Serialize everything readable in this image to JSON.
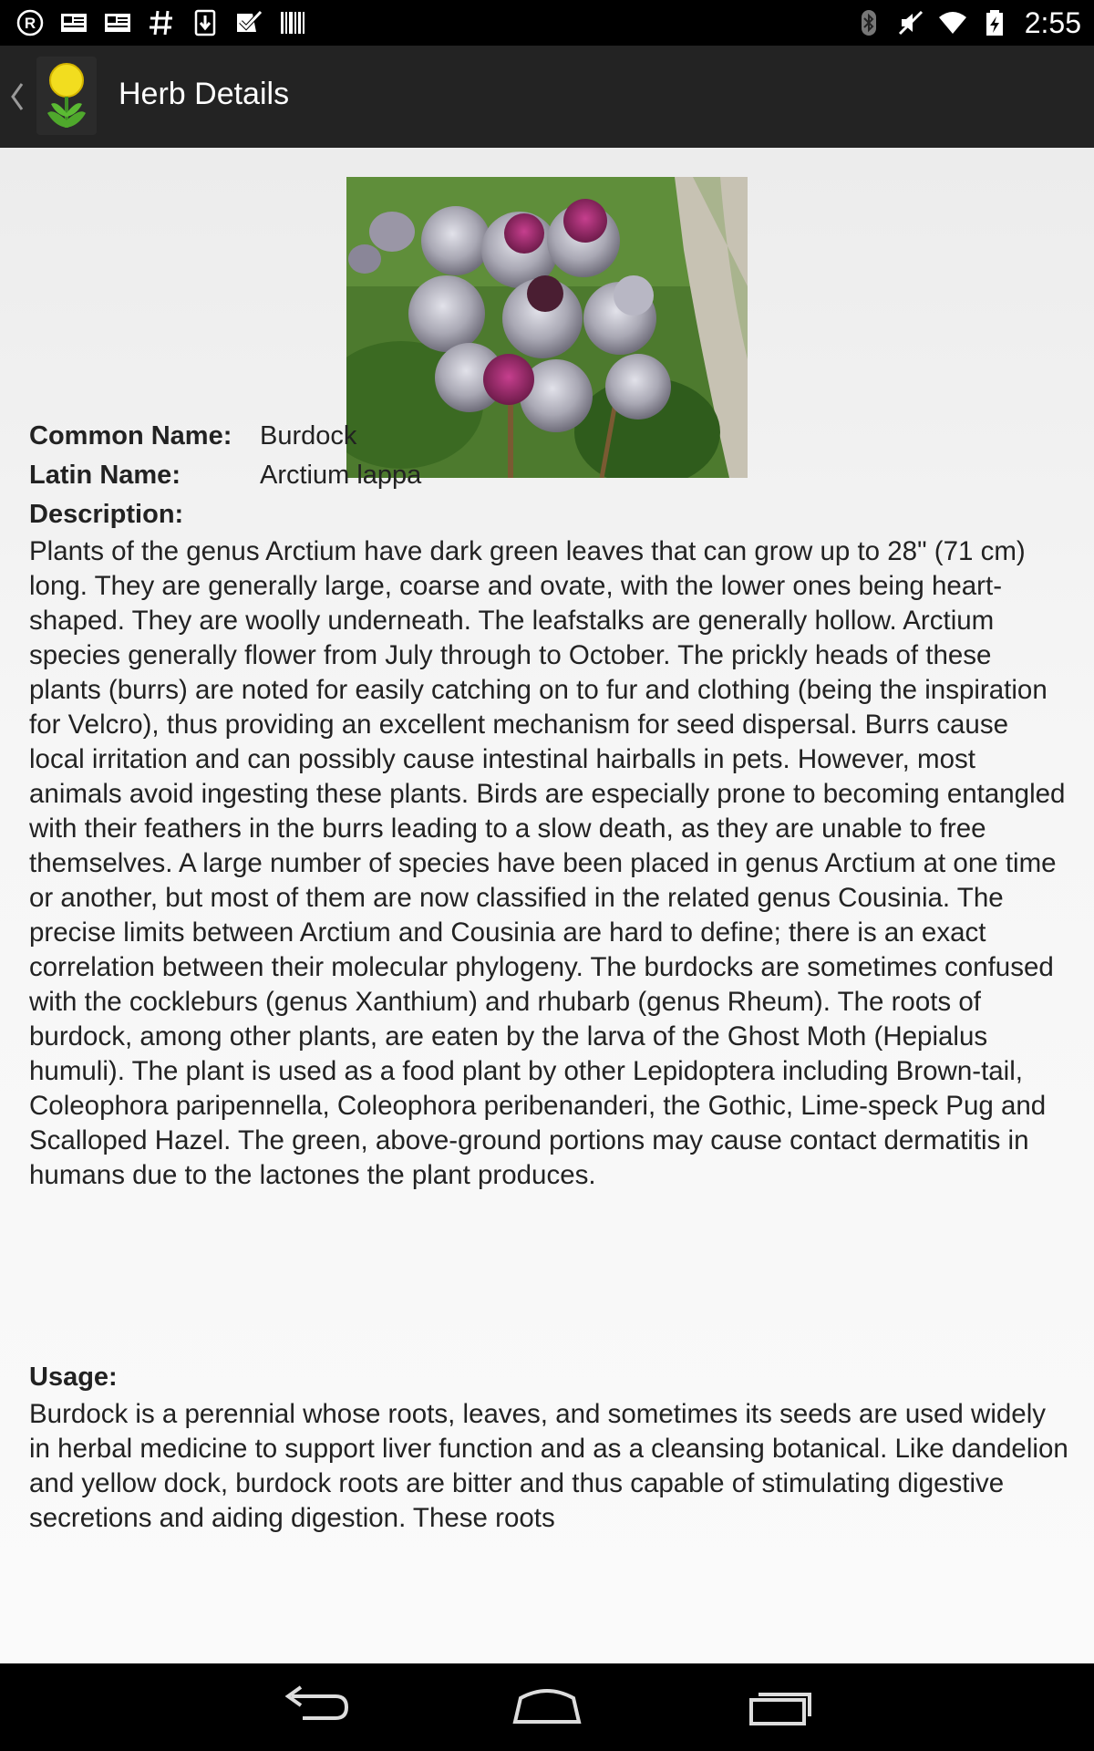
{
  "status_bar": {
    "time": "2:55",
    "left_icons": [
      "registered-icon",
      "news-icon",
      "news-icon",
      "hash-icon",
      "download-icon",
      "checkbox-icon",
      "barcode-icon"
    ],
    "right_icons": [
      "bluetooth-icon",
      "mute-icon",
      "wifi-icon",
      "battery-charging-icon"
    ]
  },
  "action_bar": {
    "title": "Herb Details"
  },
  "herb": {
    "common_name_label": "Common Name:",
    "common_name": "Burdock",
    "latin_name_label": "Latin Name:",
    "latin_name": "Arctium lappa",
    "description_label": "Description:",
    "description": "Plants of the genus Arctium have dark green leaves that can grow up to 28\" (71 cm) long. They are generally large, coarse and ovate, with the lower ones being heart-shaped. They are woolly underneath. The leafstalks are generally hollow. Arctium species generally flower from July through to October. The prickly heads of these plants (burrs) are noted for easily catching on to fur and clothing (being the inspiration for Velcro), thus providing an excellent mechanism for seed dispersal. Burrs cause local irritation and can possibly cause intestinal hairballs in pets. However, most animals avoid ingesting these plants. Birds are especially prone to becoming entangled with their feathers in the burrs leading to a slow death, as they are unable to free themselves. A large number of species have been placed in genus Arctium at one time or another, but most of them are now classified in the related genus Cousinia. The precise limits between Arctium and Cousinia are hard to define; there is an exact correlation between their molecular phylogeny. The burdocks are sometimes confused with the cockleburs (genus Xanthium) and rhubarb (genus Rheum). The roots of burdock, among other plants, are eaten by the larva of the Ghost Moth (Hepialus humuli). The plant is used as a food plant by other  Lepidoptera including Brown-tail, Coleophora paripennella, Coleophora peribenanderi, the Gothic, Lime-speck Pug and Scalloped Hazel. The green, above-ground portions may cause contact dermatitis in humans due to the lactones the plant produces.",
    "usage_label": "Usage:",
    "usage": "Burdock is a perennial whose roots, leaves, and sometimes its seeds are used widely in herbal medicine to support liver function and as a cleansing botanical. Like dandelion and yellow dock, burdock roots are bitter and thus capable of stimulating digestive secretions and aiding digestion. These roots"
  },
  "nav_bar": {
    "buttons": [
      "back-icon",
      "home-icon",
      "recents-icon"
    ]
  },
  "colors": {
    "status_bar_bg": "#000000",
    "action_bar_bg": "#232323",
    "content_bg": "#f4f4f4",
    "text": "#222222"
  }
}
